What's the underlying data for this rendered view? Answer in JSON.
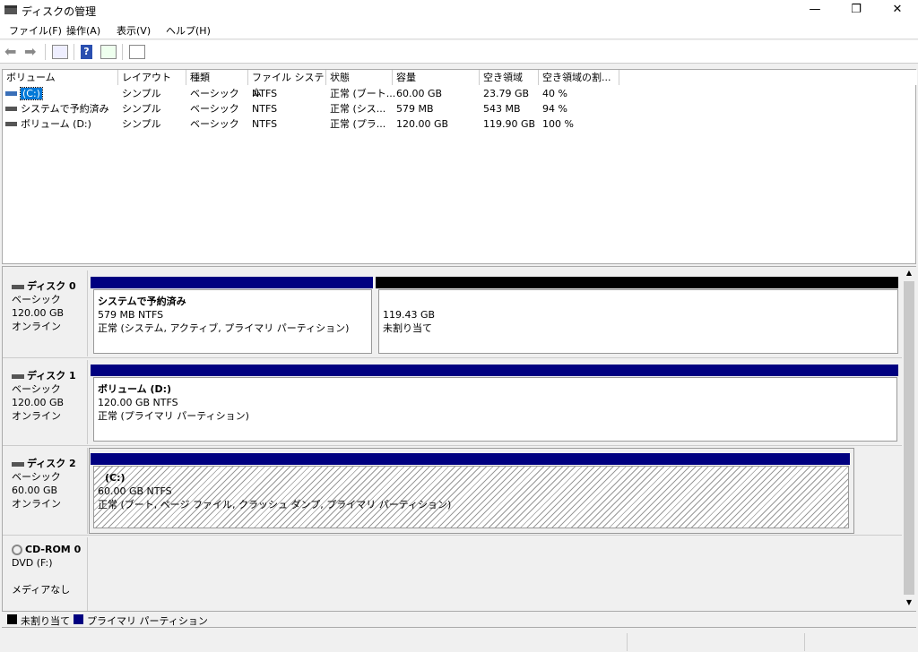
{
  "window": {
    "title": "ディスクの管理",
    "minimize": "—",
    "restore": "❐",
    "close": "✕"
  },
  "menu": [
    "ファイル(F)",
    "操作(A)",
    "表示(V)",
    "ヘルプ(H)"
  ],
  "toolbar": [
    "back-icon",
    "forward-icon",
    "console-tree-icon",
    "help-icon",
    "action-pane-icon",
    "properties-icon"
  ],
  "list": {
    "columns": [
      "ボリューム",
      "レイアウト",
      "種類",
      "ファイル システム",
      "状態",
      "容量",
      "空き領域",
      "空き領域の割..."
    ],
    "rows": [
      [
        "(C:)",
        "シンプル",
        "ベーシック",
        "NTFS",
        "正常 (ブート...",
        "60.00 GB",
        "23.79 GB",
        "40 %"
      ],
      [
        "システムで予約済み",
        "シンプル",
        "ベーシック",
        "NTFS",
        "正常 (シス...",
        "579 MB",
        "543 MB",
        "94 %"
      ],
      [
        "ボリューム (D:)",
        "シンプル",
        "ベーシック",
        "NTFS",
        "正常 (プラ...",
        "120.00 GB",
        "119.90 GB",
        "100 %"
      ]
    ]
  },
  "disks": [
    {
      "name": "ディスク 0",
      "type": "ベーシック",
      "size": "120.00 GB",
      "status": "オンライン",
      "partitions": [
        {
          "name": "システムで予約済み",
          "size": "579 MB NTFS",
          "status": "正常 (システム, アクティブ, プライマリ パーティション)"
        },
        {
          "size": "119.43 GB",
          "status": "未割り当て"
        }
      ]
    },
    {
      "name": "ディスク 1",
      "type": "ベーシック",
      "size": "120.00 GB",
      "status": "オンライン",
      "partitions": [
        {
          "name": "ボリューム  (D:)",
          "size": "120.00 GB NTFS",
          "status": "正常 (プライマリ パーティション)"
        }
      ]
    },
    {
      "name": "ディスク 2",
      "type": "ベーシック",
      "size": "60.00 GB",
      "status": "オンライン",
      "partitions": [
        {
          "name": "(C:)",
          "size": "60.00 GB NTFS",
          "status": "正常 (ブート, ページ ファイル, クラッシュ ダンプ, プライマリ パーティション)"
        }
      ]
    },
    {
      "name": "CD-ROM 0",
      "type": "DVD (F:)",
      "status": "メディアなし"
    }
  ],
  "legend": [
    {
      "label": "未割り当て",
      "color": "#000000"
    },
    {
      "label": "プライマリ パーティション",
      "color": "#000080"
    }
  ],
  "colors": {
    "primary": "#000080",
    "unallocated": "#000000",
    "selection": "#0078d7"
  }
}
